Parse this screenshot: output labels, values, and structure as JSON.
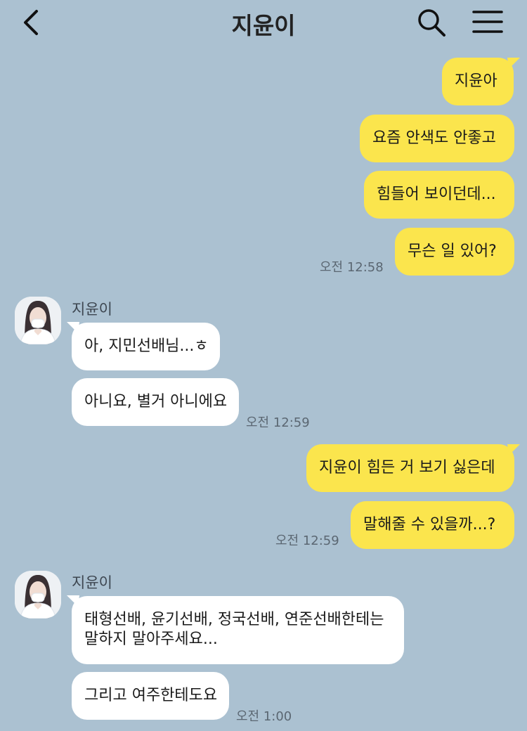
{
  "header": {
    "title": "지윤이",
    "icons": [
      "back-arrow-icon",
      "search-icon",
      "hamburger-menu-icon"
    ]
  },
  "messages": {
    "m1": "지윤아",
    "m2": "요즘 안색도 안좋고",
    "m3": "힘들어 보이던데...",
    "m4": "무슨 일 있어?",
    "t1": "오전 12:58",
    "sender1": "지윤이",
    "r1": "아, 지민선배님...ㅎ",
    "r2": "아니요, 별거 아니에요",
    "t2": "오전 12:59",
    "m5": "지윤이 힘든 거 보기 싫은데",
    "m6": "말해줄 수 있을까...?",
    "t3": "오전 12:59",
    "sender2": "지윤이",
    "r3_line1": "태형선배, 윤기선배, 정국선배, 연준선배한테는",
    "r3_line2": "말하지 말아주세요...",
    "r4": "그리고 여주한테도요",
    "t4": "오전 1:00"
  },
  "colors": {
    "background": "#abc1d1",
    "my_bubble": "#fbe54d",
    "their_bubble": "#ffffff"
  }
}
